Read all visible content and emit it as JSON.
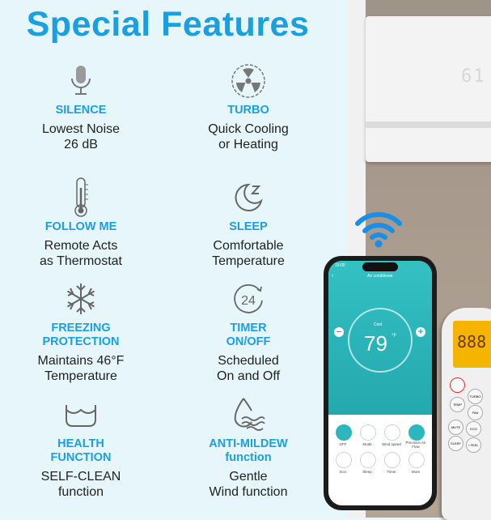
{
  "title": "Special Features",
  "colors": {
    "accent": "#1a9fe0",
    "text": "#222222",
    "app_teal": "#2bb7bd"
  },
  "features": [
    {
      "icon": "microphone-icon",
      "label_lines": [
        "SILENCE"
      ],
      "desc_lines": [
        "Lowest Noise",
        "26 dB"
      ]
    },
    {
      "icon": "turbo-fan-icon",
      "label_lines": [
        "TURBO"
      ],
      "desc_lines": [
        "Quick Cooling",
        "or Heating"
      ]
    },
    {
      "icon": "thermometer-icon",
      "label_lines": [
        "FOLLOW ME"
      ],
      "desc_lines": [
        "Remote Acts",
        "as Thermostat"
      ]
    },
    {
      "icon": "sleep-moon-icon",
      "label_lines": [
        "SLEEP"
      ],
      "desc_lines": [
        "Comfortable",
        "Temperature"
      ]
    },
    {
      "icon": "snowflake-icon",
      "label_lines": [
        "FREEZING",
        "PROTECTION"
      ],
      "desc_lines": [
        "Maintains 46°F",
        "Temperature"
      ]
    },
    {
      "icon": "24-hour-clock-icon",
      "label_lines": [
        "TIMER",
        "ON/OFF"
      ],
      "desc_lines": [
        "Scheduled",
        "On and Off"
      ]
    },
    {
      "icon": "basin-icon",
      "label_lines": [
        "HEALTH",
        "FUNCTION"
      ],
      "desc_lines": [
        "SELF-CLEAN",
        "function"
      ]
    },
    {
      "icon": "water-drop-icon",
      "label_lines": [
        "ANTI-MILDEW",
        "function"
      ],
      "desc_lines": [
        "Gentle",
        "Wind function"
      ]
    }
  ],
  "ac_display": "61",
  "phone": {
    "time": "15:00",
    "app_title": "Air conditioner",
    "mode_label": "Cool",
    "temperature": "79",
    "unit": "°F",
    "buttons_row1": [
      "OFF",
      "Mode",
      "Wind speed",
      "Precision Air Flow"
    ],
    "buttons_row2": [
      "Eco",
      "Sleep",
      "Timer",
      "More"
    ]
  },
  "remote": {
    "lcd_digits": "888",
    "buttons": [
      "TEMP",
      "TURBO",
      "FAN",
      "MUTE",
      "ECO",
      "SLEEP",
      "I FEEL"
    ]
  }
}
